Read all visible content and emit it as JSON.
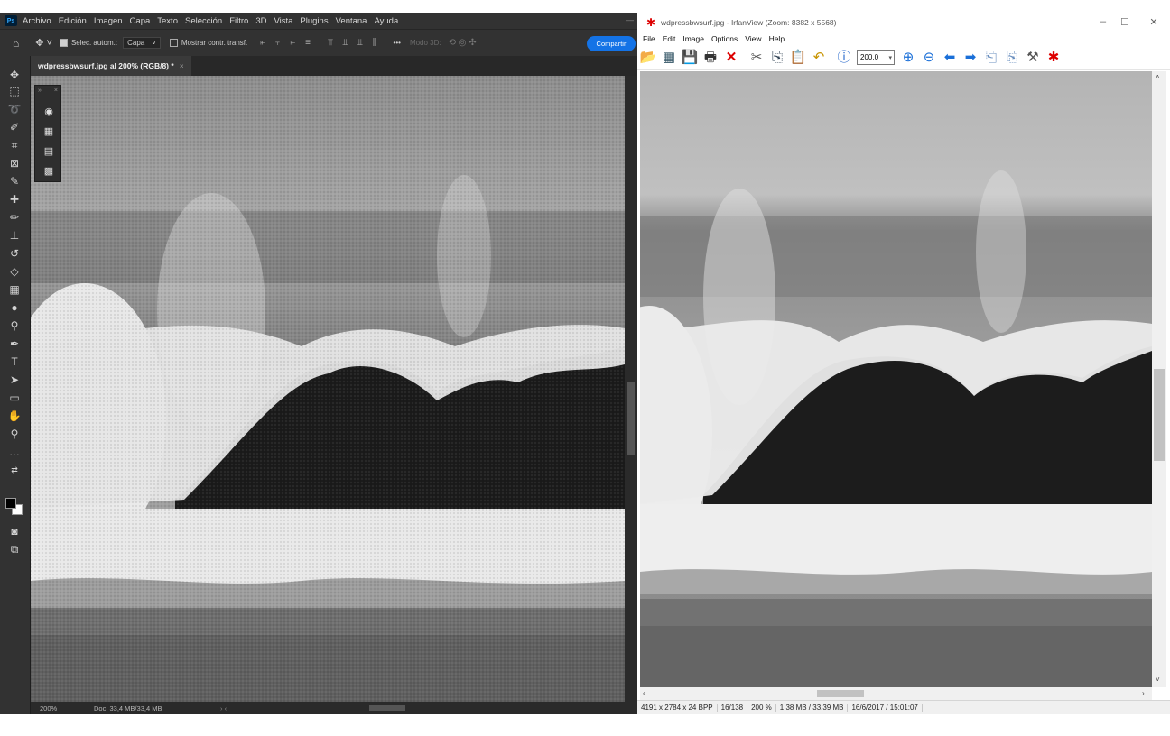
{
  "photoshop": {
    "logo": "Ps",
    "menus": [
      "Archivo",
      "Edición",
      "Imagen",
      "Capa",
      "Texto",
      "Selección",
      "Filtro",
      "3D",
      "Vista",
      "Plugins",
      "Ventana",
      "Ayuda"
    ],
    "options": {
      "auto_select_label": "Selec. autom.:",
      "layer_select": "Capa",
      "transform_label": "Mostrar contr. transf.",
      "more": "•••",
      "mode_3d": "Modo 3D:",
      "share": "Compartir"
    },
    "document_tab": {
      "title": "wdpressbwsurf.jpg al 200% (RGB/8) *",
      "close": "×"
    },
    "tools": [
      "move-tool",
      "marquee-tool",
      "lasso-tool",
      "quick-select-tool",
      "crop-tool",
      "frame-tool",
      "eyedropper-tool",
      "healing-tool",
      "brush-tool",
      "stamp-tool",
      "history-brush-tool",
      "eraser-tool",
      "gradient-tool",
      "blur-tool",
      "dodge-tool",
      "pen-tool",
      "type-tool",
      "path-select-tool",
      "rectangle-tool",
      "hand-tool",
      "zoom-tool",
      "edit-toolbar",
      "swap-colors",
      "quick-mask",
      "screen-mode"
    ],
    "status": {
      "zoom": "200%",
      "doc": "Doc: 33,4 MB/33,4 MB",
      "nav": "›  ‹"
    },
    "colors": {
      "foreground": "#000000",
      "background": "#ffffff",
      "accent": "#1473e6"
    }
  },
  "irfanview": {
    "title": "wdpressbwsurf.jpg - IrfanView (Zoom: 8382 x 5568)",
    "window_buttons": {
      "minimize": "–",
      "maximize": "☐",
      "close": "✕"
    },
    "menus": [
      "File",
      "Edit",
      "Image",
      "Options",
      "View",
      "Help"
    ],
    "zoom_value": "200.0",
    "toolbar_icons": [
      "open-icon",
      "slideshow-icon",
      "save-icon",
      "print-icon",
      "delete-icon",
      "cut-icon",
      "copy-icon",
      "paste-icon",
      "undo-icon",
      "info-icon",
      "zoom-in-icon",
      "zoom-out-icon",
      "prev-icon",
      "next-icon",
      "first-page-icon",
      "last-page-icon",
      "settings-icon",
      "exit-icon"
    ],
    "status": [
      "4191 x 2784 x 24 BPP",
      "16/138",
      "200 %",
      "1.38 MB / 33.39 MB",
      "16/6/2017 / 15:01:07"
    ]
  }
}
